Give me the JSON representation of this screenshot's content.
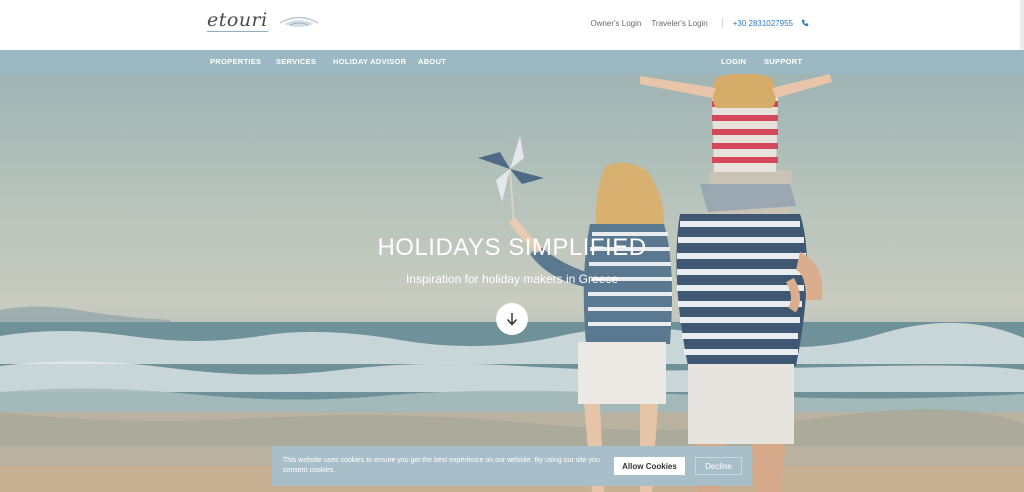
{
  "header": {
    "logo_text": "etouri",
    "owners_login": "Owner's Login",
    "travelers_login": "Traveler's Login",
    "phone": "+30 2831027955"
  },
  "nav": {
    "properties": "PROPERTIES",
    "services": "SERVICES",
    "holiday_advisor": "HOLIDAY ADVISOR",
    "about": "ABOUT",
    "login": "LOGIN",
    "support": "SUPPORT"
  },
  "hero": {
    "title": "HOLIDAYS SIMPLIFIED",
    "subtitle": "Inspiration for holiday makers in Greece",
    "scroll_icon": "arrow-down-icon"
  },
  "cookie": {
    "text": "This website uses cookies to ensure you get the best experience on our website. By using our site you consent cookies.",
    "allow_label": "Allow Cookies",
    "decline_label": "Decline"
  },
  "colors": {
    "nav_bg": "#9cb8c3",
    "phone_link": "#2b7cc9",
    "cookie_bg": "#a8bfc9"
  }
}
